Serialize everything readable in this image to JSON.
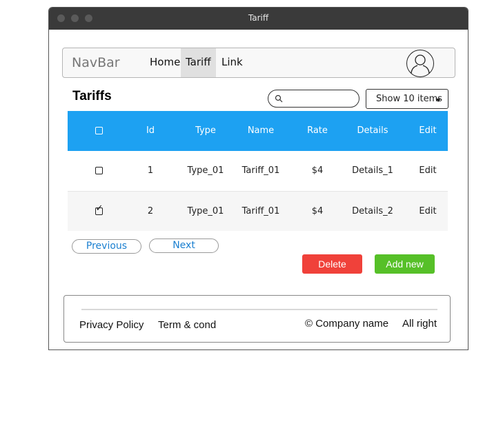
{
  "window": {
    "title": "Tariff"
  },
  "navbar": {
    "brand": "NavBar",
    "links": [
      {
        "label": "Home",
        "active": false
      },
      {
        "label": "Tariff",
        "active": true
      },
      {
        "label": "Link",
        "active": false
      }
    ],
    "avatar_icon": "user-avatar-icon"
  },
  "main": {
    "title": "Tariffs",
    "search": {
      "placeholder": "",
      "icon": "search-icon"
    },
    "page_size_select": {
      "value": "Show 10 items"
    }
  },
  "table": {
    "header_color": "#1da1f2",
    "columns": [
      "",
      "Id",
      "Type",
      "Name",
      "Rate",
      "Details",
      "Edit"
    ],
    "rows": [
      {
        "checked": false,
        "id": "1",
        "type": "Type_01",
        "name": "Tariff_01",
        "rate": "$4",
        "details": "Details_1",
        "edit": "Edit"
      },
      {
        "checked": true,
        "id": "2",
        "type": "Type_01",
        "name": "Tariff_01",
        "rate": "$4",
        "details": "Details_2",
        "edit": "Edit"
      }
    ]
  },
  "pagination": {
    "previous": "Previous",
    "next": "Next"
  },
  "actions": {
    "delete": "Delete",
    "add_new": "Add new",
    "delete_color": "#f0413a",
    "add_color": "#56c028"
  },
  "footer": {
    "privacy": "Privacy Policy",
    "terms": "Term & cond",
    "company": "© Company name",
    "rights": "All right"
  }
}
